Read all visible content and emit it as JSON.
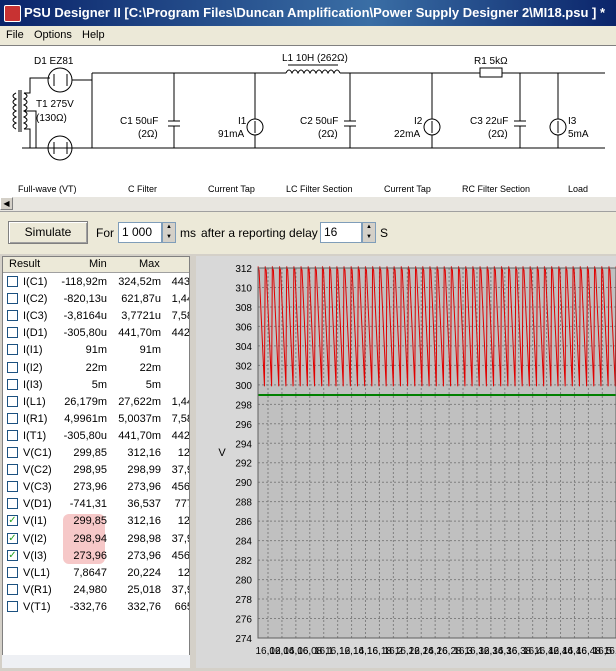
{
  "window": {
    "title": "PSU Designer II  [C:\\Program Files\\Duncan Amplification\\Power Supply Designer 2\\MI18.psu ] *"
  },
  "menu": [
    "File",
    "Options",
    "Help"
  ],
  "schematic": {
    "components": {
      "d1": "D1 EZ81",
      "t1": "T1 275V",
      "t1_r": "(130Ω)",
      "c1": "C1 50uF",
      "c1_r": "(2Ω)",
      "i1": "I1",
      "i1_v": "91mA",
      "l1": "L1 10H (262Ω)",
      "c2": "C2 50uF",
      "c2_r": "(2Ω)",
      "i2": "I2",
      "i2_v": "22mA",
      "r1": "R1 5kΩ",
      "c3": "C3 22uF",
      "c3_r": "(2Ω)",
      "i3": "I3",
      "i3_v": "5mA"
    },
    "sections": [
      "Full-wave (VT)",
      "C Filter",
      "Current Tap",
      "LC Filter Section",
      "Current Tap",
      "RC Filter Section",
      "Load"
    ]
  },
  "controls": {
    "simulate_label": "Simulate",
    "for_label": "For",
    "duration": "1 000",
    "ms_label": "ms",
    "delay_label": "after a reporting delay of",
    "delay": "16",
    "s_label": "S"
  },
  "results": {
    "headers": [
      "Result",
      "Min",
      "Max"
    ],
    "rows": [
      {
        "name": "I(C1)",
        "min": "-118,92m",
        "max": "324,52m",
        "extra": "443,",
        "checked": false
      },
      {
        "name": "I(C2)",
        "min": "-820,13u",
        "max": "621,87u",
        "extra": "1,44",
        "checked": false
      },
      {
        "name": "I(C3)",
        "min": "-3,8164u",
        "max": "3,7721u",
        "extra": "7,58",
        "checked": false
      },
      {
        "name": "I(D1)",
        "min": "-305,80u",
        "max": "441,70m",
        "extra": "442,",
        "checked": false
      },
      {
        "name": "I(I1)",
        "min": "91m",
        "max": "91m",
        "extra": "",
        "checked": false
      },
      {
        "name": "I(I2)",
        "min": "22m",
        "max": "22m",
        "extra": "",
        "checked": false
      },
      {
        "name": "I(I3)",
        "min": "5m",
        "max": "5m",
        "extra": "",
        "checked": false
      },
      {
        "name": "I(L1)",
        "min": "26,179m",
        "max": "27,622m",
        "extra": "1,44",
        "checked": false
      },
      {
        "name": "I(R1)",
        "min": "4,9961m",
        "max": "5,0037m",
        "extra": "7,58",
        "checked": false
      },
      {
        "name": "I(T1)",
        "min": "-305,80u",
        "max": "441,70m",
        "extra": "442,",
        "checked": false
      },
      {
        "name": "V(C1)",
        "min": "299,85",
        "max": "312,16",
        "extra": "12,",
        "checked": false
      },
      {
        "name": "V(C2)",
        "min": "298,95",
        "max": "298,99",
        "extra": "37,9",
        "checked": false
      },
      {
        "name": "V(C3)",
        "min": "273,96",
        "max": "273,96",
        "extra": "456,",
        "checked": false
      },
      {
        "name": "V(D1)",
        "min": "-741,31",
        "max": "36,537",
        "extra": "777",
        "checked": false
      },
      {
        "name": "V(I1)",
        "min": "299,85",
        "max": "312,16",
        "extra": "12,",
        "checked": true
      },
      {
        "name": "V(I2)",
        "min": "298,94",
        "max": "298,98",
        "extra": "37,9",
        "checked": true
      },
      {
        "name": "V(I3)",
        "min": "273,96",
        "max": "273,96",
        "extra": "456,",
        "checked": true
      },
      {
        "name": "V(L1)",
        "min": "7,8647",
        "max": "20,224",
        "extra": "12,",
        "checked": false
      },
      {
        "name": "V(R1)",
        "min": "24,980",
        "max": "25,018",
        "extra": "37,9",
        "checked": false
      },
      {
        "name": "V(T1)",
        "min": "-332,76",
        "max": "332,76",
        "extra": "665",
        "checked": false
      }
    ]
  },
  "chart_data": {
    "type": "line",
    "ylabel": "V",
    "ylim": [
      274,
      312
    ],
    "yticks": [
      312,
      310,
      308,
      306,
      304,
      302,
      300,
      298,
      296,
      294,
      292,
      290,
      288,
      286,
      284,
      282,
      280,
      278,
      276,
      274
    ],
    "x_tick_labels": [
      "16,02",
      "16,04",
      "16,06",
      "16,08",
      "16,1",
      "16,12",
      "16,14",
      "16,16",
      "16,18",
      "16,2",
      "16,22",
      "16,24",
      "16,26",
      "16,28",
      "16,3",
      "16,32",
      "16,34",
      "16,36",
      "16,38",
      "16,4",
      "16,42",
      "16,44",
      "16,46",
      "16,48",
      "16,5",
      "16,52"
    ],
    "grid": true,
    "series": [
      {
        "label": "V(I1)",
        "color": "#e00000",
        "style": "ripple",
        "min": 299.85,
        "max": 312.16,
        "cycles": 50
      },
      {
        "label": "V(I2)",
        "color": "#008000",
        "style": "flat",
        "value": 298.96
      },
      {
        "label": "V(I3)",
        "color": "#0000ff",
        "style": "flat",
        "value": 273.96
      }
    ]
  }
}
